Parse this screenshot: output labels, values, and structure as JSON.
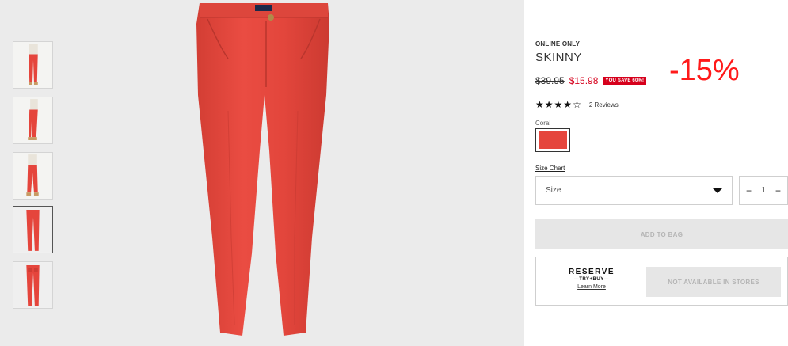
{
  "gallery": {
    "thumbnails": [
      {
        "kind": "worn-front"
      },
      {
        "kind": "worn-side"
      },
      {
        "kind": "worn-front-2"
      },
      {
        "kind": "flat-front",
        "active": true
      },
      {
        "kind": "flat-back"
      }
    ],
    "product_color": "#e5453c"
  },
  "product": {
    "badge": "ONLINE ONLY",
    "name": "SKINNY",
    "price_original": "$39.95",
    "price_sale": "$15.98",
    "save_badge": "YOU SAVE 60%!",
    "discount_overlay": "-15%",
    "rating": {
      "stars": [
        "★",
        "★",
        "★",
        "★",
        "☆"
      ],
      "value": 4,
      "out_of": 5,
      "reviews_label": "2 Reviews"
    },
    "color_label": "Coral",
    "swatch_color": "#e5453c",
    "size_chart_label": "Size Chart",
    "size_placeholder": "Size",
    "quantity": {
      "minus": "−",
      "value": "1",
      "plus": "+"
    },
    "add_to_bag": "ADD TO BAG"
  },
  "reserve": {
    "title": "RESERVE",
    "subtitle": "—TRY+BUY—",
    "learn_more": "Learn More",
    "not_available": "NOT AVAILABLE IN STORES"
  },
  "colors": {
    "sale_red": "#d6001c",
    "overlay_red": "#ff1a1a",
    "disabled_bg": "#e6e6e6"
  }
}
